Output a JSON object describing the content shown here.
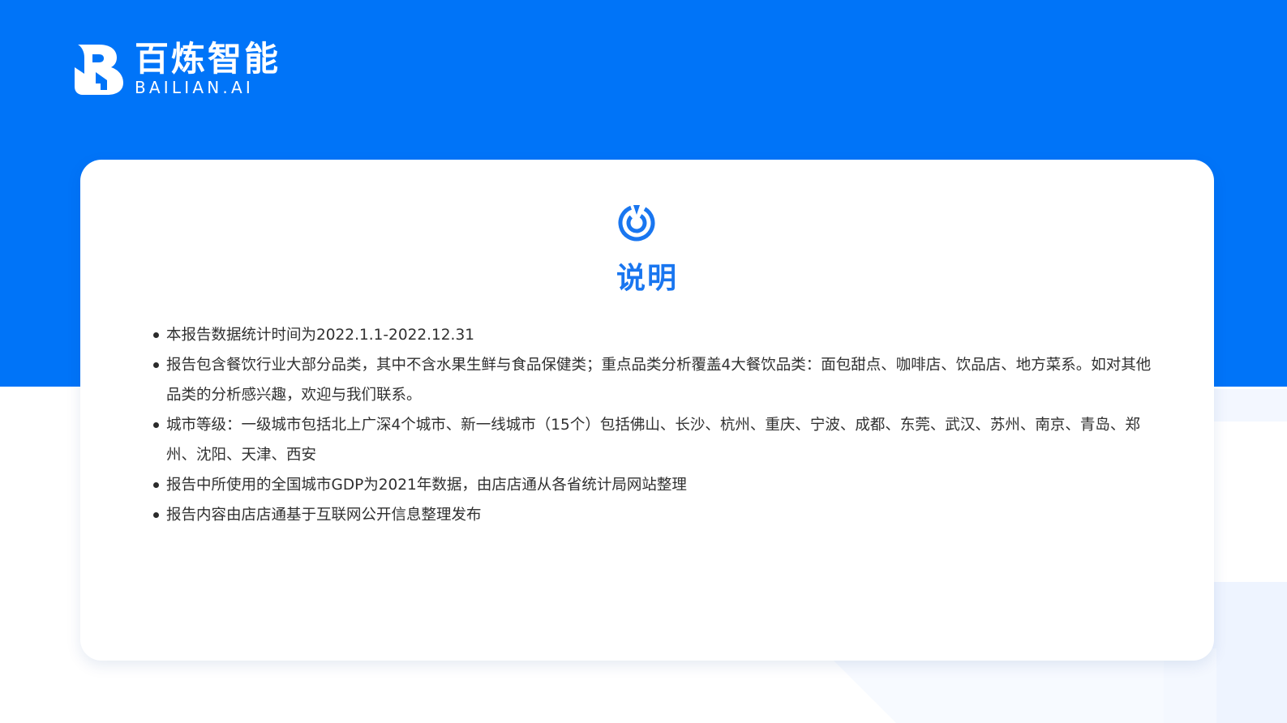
{
  "brand": {
    "name_cn": "百炼智能",
    "name_en": "BAILIAN.AI"
  },
  "card": {
    "title": "说明",
    "items": [
      "本报告数据统计时间为2022.1.1-2022.12.31",
      "报告包含餐饮行业大部分品类，其中不含水果生鲜与食品保健类；重点品类分析覆盖4大餐饮品类：面包甜点、咖啡店、饮品店、地方菜系。如对其他品类的分析感兴趣，欢迎与我们联系。",
      "城市等级：一级城市包括北上广深4个城市、新一线城市（15个）包括佛山、长沙、杭州、重庆、宁波、成都、东莞、武汉、苏州、南京、青岛、郑州、沈阳、天津、西安",
      "报告中所使用的全国城市GDP为2021年数据，由店店通从各省统计局网站整理",
      "报告内容由店店通基于互联网公开信息整理发布"
    ]
  },
  "colors": {
    "brand_blue": "#0074f8",
    "title_blue": "#1976f0"
  },
  "icons": {
    "logo": "bailian-logo-icon",
    "card": "target-ring-icon"
  }
}
